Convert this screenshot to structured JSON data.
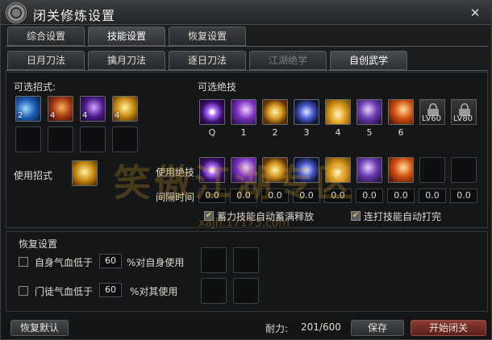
{
  "window": {
    "title": "闭关修炼设置",
    "close_symbol": "✕"
  },
  "main_tabs": [
    {
      "label": "综合设置",
      "active": false
    },
    {
      "label": "技能设置",
      "active": true
    },
    {
      "label": "恢复设置",
      "active": false
    }
  ],
  "sub_tabs": [
    {
      "label": "日月刀法",
      "active": false
    },
    {
      "label": "擒月刀法",
      "active": false
    },
    {
      "label": "逐日刀法",
      "active": false
    },
    {
      "label": "江湖绝学",
      "disabled": true
    },
    {
      "label": "自创武学",
      "active": true
    }
  ],
  "moves": {
    "title": "可选招式:",
    "items": [
      {
        "icon": "blue-slash-icon",
        "count": "2"
      },
      {
        "icon": "fire-warrior-icon",
        "count": "4"
      },
      {
        "icon": "purple-crescent-icon",
        "count": "4"
      },
      {
        "icon": "golden-strike-icon",
        "count": "4"
      }
    ],
    "use_label": "使用招式"
  },
  "ultimates": {
    "title": "可选绝技",
    "items": [
      {
        "icon": "purple-beam-icon",
        "hotkey": "Q"
      },
      {
        "icon": "violet-blades-icon",
        "hotkey": "1"
      },
      {
        "icon": "golden-whirl-icon",
        "hotkey": "2"
      },
      {
        "icon": "blue-vortex-icon",
        "hotkey": "3"
      },
      {
        "icon": "golden-wave-icon",
        "hotkey": "4"
      },
      {
        "icon": "lightning-icon",
        "hotkey": "5"
      },
      {
        "icon": "flame-burst-icon",
        "hotkey": "6"
      }
    ],
    "locked": [
      {
        "level": "LV60"
      },
      {
        "level": "LV80"
      }
    ],
    "use_label": "使用绝技",
    "interval_label": "间隔时间",
    "intervals": [
      "0.0",
      "0.0",
      "0.0",
      "0.0",
      "0.0",
      "0.0",
      "0.0",
      "0.0",
      "0.0"
    ],
    "charge_option": "蓄力技能自动蓄满释放",
    "combo_option": "连打技能自动打完"
  },
  "recovery": {
    "title": "恢复设置",
    "self_prefix": "自身气血低于",
    "self_value": "60",
    "self_suffix": "%对自身使用",
    "pet_prefix": "门徒气血低于",
    "pet_value": "60",
    "pet_suffix": "%对其使用"
  },
  "footer": {
    "reset": "恢复默认",
    "durability_label": "耐力:",
    "durability_value": "201/600",
    "save": "保存",
    "start": "开始闭关"
  },
  "watermark": {
    "text": "笑傲江湖专区",
    "url": "xajh.17173.com"
  }
}
